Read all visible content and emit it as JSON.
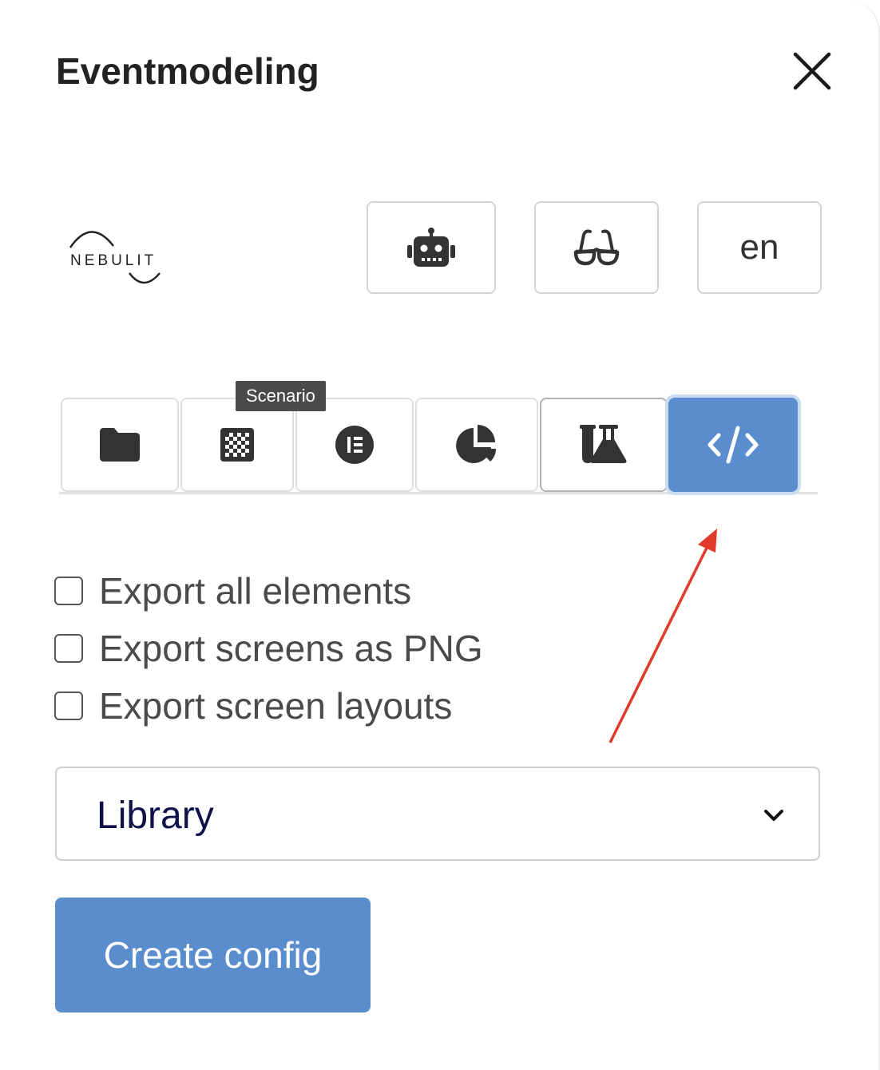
{
  "header": {
    "title": "Eventmodeling"
  },
  "logo": {
    "text": "NEBULIT"
  },
  "top_buttons": [
    {
      "icon": "robot-icon"
    },
    {
      "icon": "glasses-icon"
    },
    {
      "label": "en"
    }
  ],
  "tabs": [
    {
      "icon": "folder-icon"
    },
    {
      "icon": "checkerboard-icon",
      "tooltip": "Scenario"
    },
    {
      "icon": "list-circle-icon"
    },
    {
      "icon": "pie-chart-icon"
    },
    {
      "icon": "flask-icon"
    },
    {
      "icon": "code-icon",
      "selected": true
    }
  ],
  "options": [
    {
      "label": "Export all elements",
      "checked": false
    },
    {
      "label": "Export screens as PNG",
      "checked": false
    },
    {
      "label": "Export screen layouts",
      "checked": false
    }
  ],
  "select": {
    "value": "Library"
  },
  "primary_button": {
    "label": "Create config"
  },
  "colors": {
    "accent": "#5a8dcd",
    "annotation_arrow": "#e03a2a",
    "text_dark": "#222222"
  }
}
